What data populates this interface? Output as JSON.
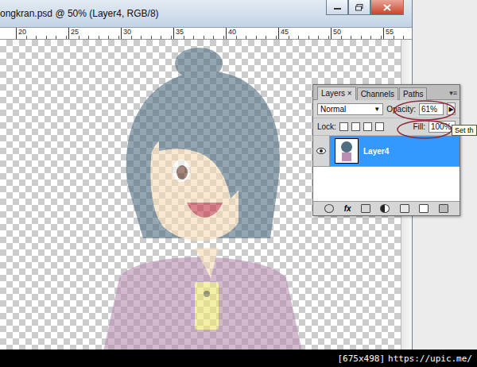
{
  "window": {
    "title": "ongkran.psd @ 50% (Layer4, RGB/8)"
  },
  "ruler": {
    "ticks": [
      "20",
      "25",
      "30",
      "35",
      "40",
      "45",
      "50",
      "55"
    ]
  },
  "layers_panel": {
    "tabs": [
      {
        "label": "Layers",
        "selected": true,
        "close": "×"
      },
      {
        "label": "Channels",
        "selected": false,
        "close": ""
      },
      {
        "label": "Paths",
        "selected": false,
        "close": ""
      }
    ],
    "blend_mode": "Normal",
    "opacity_label": "Opacity:",
    "opacity": "61%",
    "level": 0.61,
    "lock_label": "Lock:",
    "fill_label": "Fill:",
    "fill": "100%",
    "fx_label": "fx",
    "layers": [
      {
        "name": "Layer4",
        "visible": true,
        "selected": true
      }
    ]
  },
  "tooltip": {
    "text": "Set th"
  },
  "watermark": {
    "size": "[675x498]",
    "url": "https://upic.me/"
  }
}
